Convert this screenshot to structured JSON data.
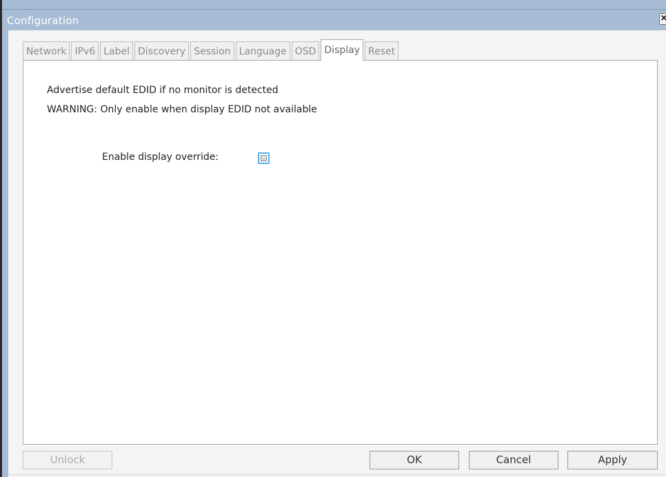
{
  "window": {
    "title": "Configuration",
    "close_glyph": "×"
  },
  "tabs": [
    {
      "label": "Network",
      "active": false
    },
    {
      "label": "IPv6",
      "active": false
    },
    {
      "label": "Label",
      "active": false
    },
    {
      "label": "Discovery",
      "active": false
    },
    {
      "label": "Session",
      "active": false
    },
    {
      "label": "Language",
      "active": false
    },
    {
      "label": "OSD",
      "active": false
    },
    {
      "label": "Display",
      "active": true
    },
    {
      "label": "Reset",
      "active": false
    }
  ],
  "display": {
    "description": "Advertise default EDID if no monitor is detected",
    "warning": "WARNING: Only enable when display EDID not available",
    "override_label": "Enable display override:",
    "override_checked": false
  },
  "buttons": {
    "unlock": "Unlock",
    "ok": "OK",
    "cancel": "Cancel",
    "apply": "Apply"
  },
  "colors": {
    "title_bar": "#a7bcd5",
    "focus_ring": "#5aaee8"
  }
}
